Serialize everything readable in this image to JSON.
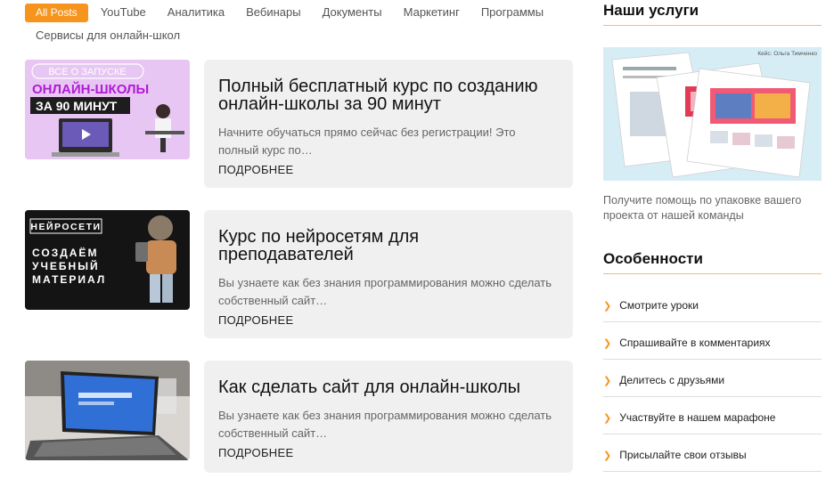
{
  "tabs": [
    {
      "label": "All Posts"
    },
    {
      "label": "YouTube"
    },
    {
      "label": "Аналитика"
    },
    {
      "label": "Вебинары"
    },
    {
      "label": "Документы"
    },
    {
      "label": "Маркетинг"
    },
    {
      "label": "Программы"
    },
    {
      "label": "Сервисы для онлайн-школ"
    }
  ],
  "posts": [
    {
      "title": "Полный бесплатный курс по созданию онлайн-школы за 90 минут",
      "excerpt": "Начните обучаться прямо сейчас без регистрации! Это полный курс по…",
      "more": "ПОДРОБНЕЕ",
      "thumb": {
        "line1": "ВСЕ О ЗАПУСКЕ",
        "line2": "ОНЛАЙН-ШКОЛЫ",
        "line3": "ЗА 90 МИНУТ"
      }
    },
    {
      "title": "Курс по нейросетям для преподавателей",
      "excerpt": "Вы узнаете как без знания программирования можно сделать собственный сайт…",
      "more": "ПОДРОБНЕЕ",
      "thumb": {
        "badge": "НЕЙРОСЕТИ",
        "line1": "СОЗДАЁМ",
        "line2": "УЧЕБНЫЙ",
        "line3": "МАТЕРИАЛ"
      }
    },
    {
      "title": "Как сделать сайт для онлайн-школы",
      "excerpt": "Вы узнаете как без знания программирования можно сделать собственный сайт…",
      "more": "ПОДРОБНЕЕ"
    }
  ],
  "sidebar": {
    "services_title": "Наши услуги",
    "promo_caption": "Кейс: Ольга Тимченко",
    "promo_text": "Получите помощь по упаковке вашего проекта от нашей команды",
    "features_title": "Особенности",
    "features": [
      {
        "label": "Смотрите уроки"
      },
      {
        "label": "Спрашивайте в комментариях"
      },
      {
        "label": "Делитесь с друзьями"
      },
      {
        "label": "Участвуйте в нашем марафоне"
      },
      {
        "label": "Присылайте свои отзывы"
      }
    ]
  },
  "colors": {
    "accent": "#f7941d",
    "card_bg": "#f0f0f0"
  }
}
